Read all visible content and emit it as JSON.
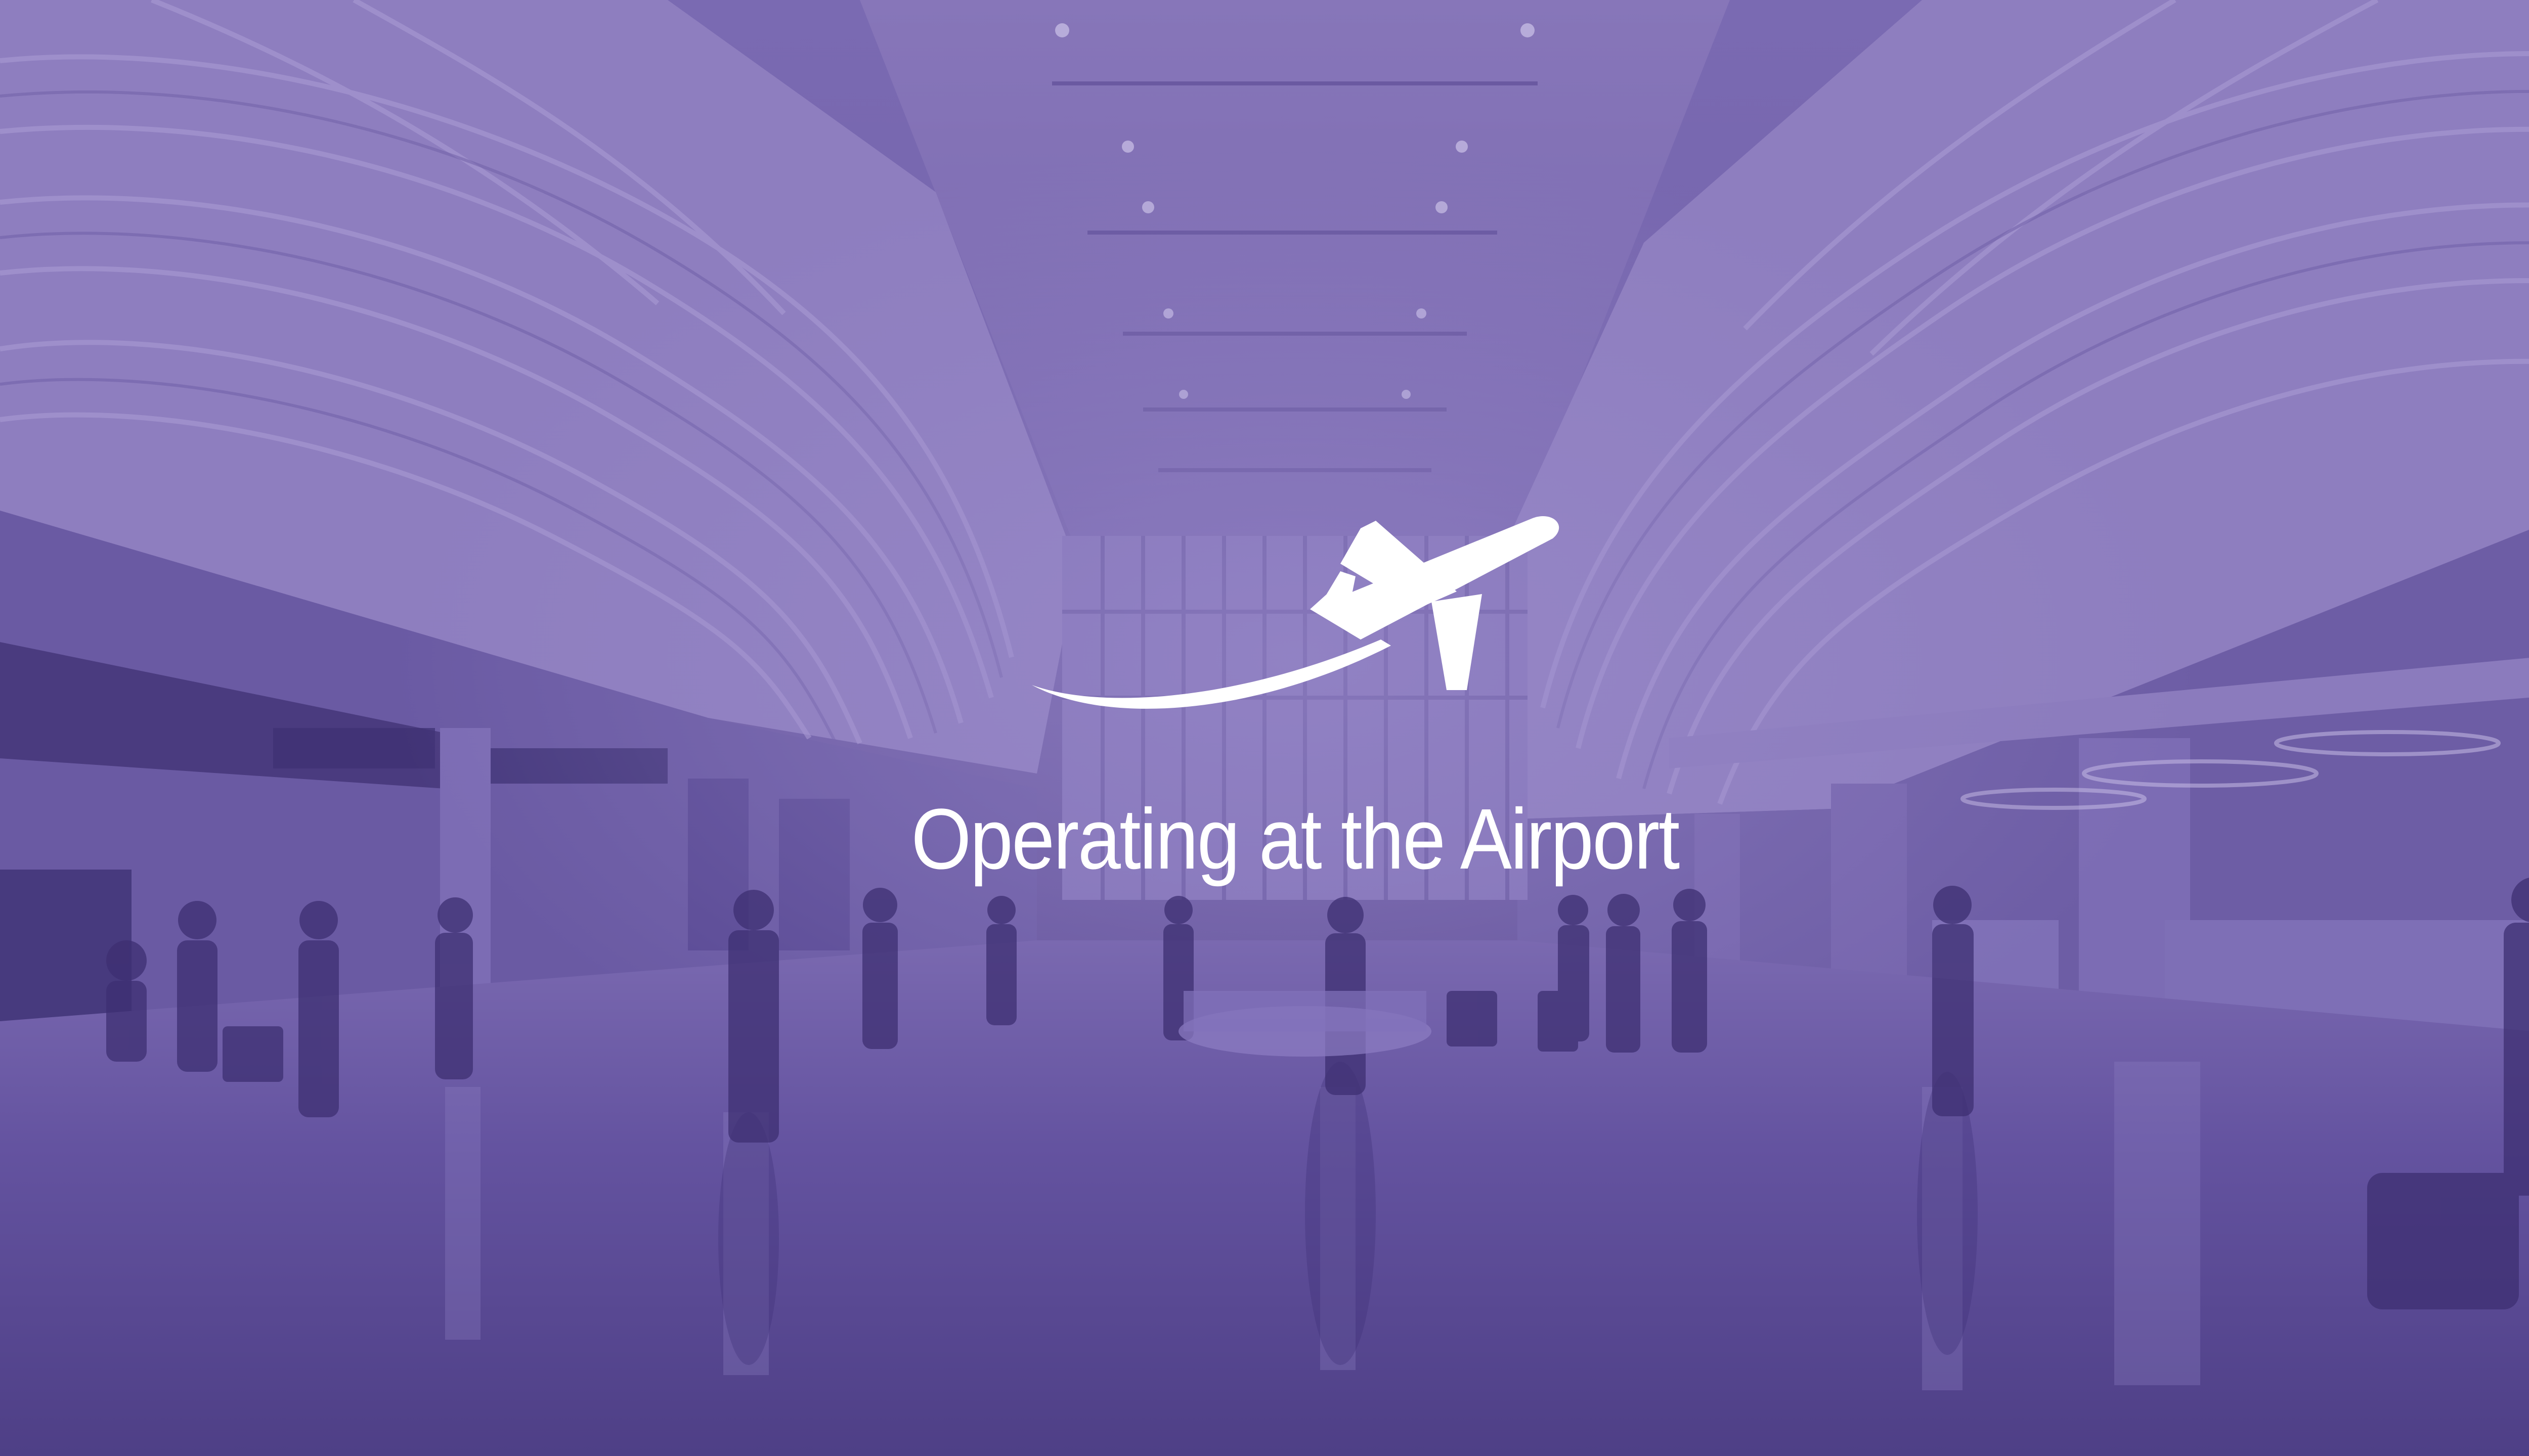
{
  "slide": {
    "title": "Operating at the Airport",
    "background_image": "airport-terminal-concourse",
    "overlay_color": "#6f5ea8",
    "title_color": "#ffffff"
  },
  "icons": {
    "plane": "airplane-takeoff-icon"
  }
}
